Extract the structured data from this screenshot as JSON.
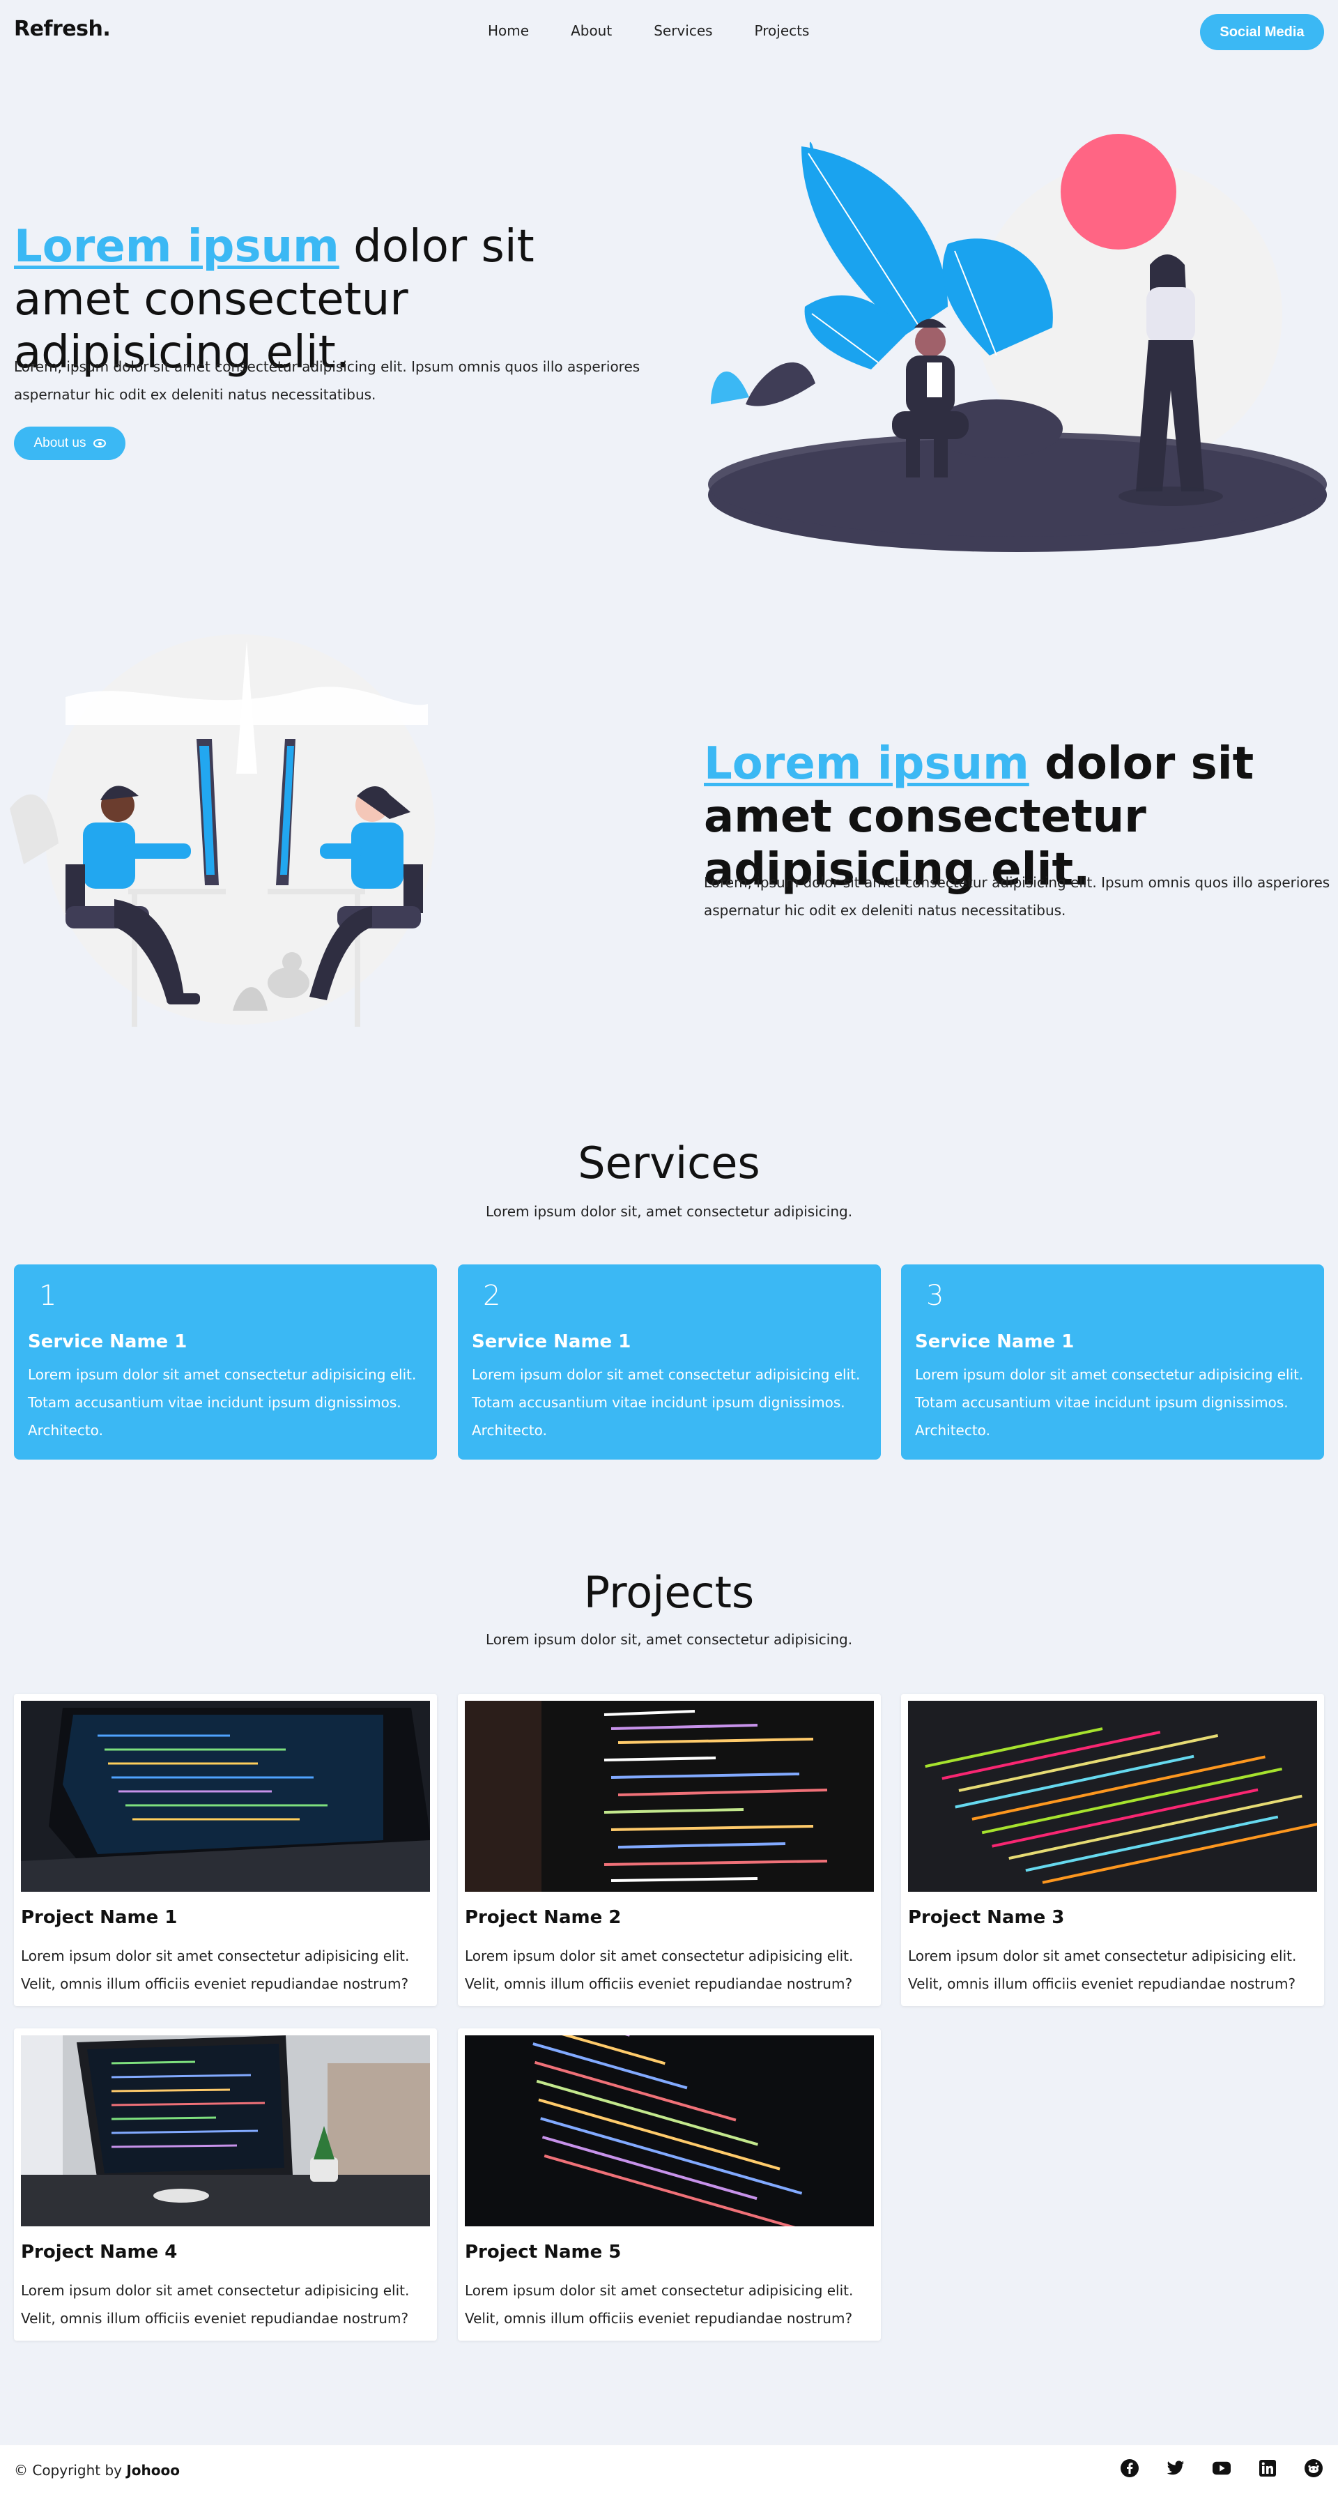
{
  "nav": {
    "logo": "Refresh.",
    "links": [
      "Home",
      "About",
      "Services",
      "Projects"
    ],
    "cta": "Social Media"
  },
  "hero": {
    "title_accent": "Lorem ipsum",
    "title_rest": " dolor sit amet consectetur adipisicing elit.",
    "text": "Lorem, ipsum dolor sit amet consectetur adipisicing elit. Ipsum omnis quos illo asperiores aspernatur hic odit ex deleniti natus necessitatibus.",
    "button": "About us"
  },
  "about": {
    "title_accent": "Lorem ipsum",
    "title_rest": " dolor sit amet consectetur adipisicing elit.",
    "text": "Lorem, ipsum dolor sit amet consectetur adipisicing elit. Ipsum omnis quos illo asperiores aspernatur hic odit ex deleniti natus necessitatibus."
  },
  "services": {
    "heading": "Services",
    "subtitle": "Lorem ipsum dolor sit, amet consectetur adipisicing.",
    "items": [
      {
        "num": "1",
        "name": "Service Name 1",
        "desc": "Lorem ipsum dolor sit amet consectetur adipisicing elit. Totam accusantium vitae incidunt ipsum dignissimos. Architecto."
      },
      {
        "num": "2",
        "name": "Service Name 1",
        "desc": "Lorem ipsum dolor sit amet consectetur adipisicing elit. Totam accusantium vitae incidunt ipsum dignissimos. Architecto."
      },
      {
        "num": "3",
        "name": "Service Name 1",
        "desc": "Lorem ipsum dolor sit amet consectetur adipisicing elit. Totam accusantium vitae incidunt ipsum dignissimos. Architecto."
      }
    ]
  },
  "projects": {
    "heading": "Projects",
    "subtitle": "Lorem ipsum dolor sit, amet consectetur adipisicing.",
    "items": [
      {
        "name": "Project Name 1",
        "desc": "Lorem ipsum dolor sit amet consectetur adipisicing elit. Velit, omnis illum officiis eveniet repudiandae nostrum?"
      },
      {
        "name": "Project Name 2",
        "desc": "Lorem ipsum dolor sit amet consectetur adipisicing elit. Velit, omnis illum officiis eveniet repudiandae nostrum?"
      },
      {
        "name": "Project Name 3",
        "desc": "Lorem ipsum dolor sit amet consectetur adipisicing elit. Velit, omnis illum officiis eveniet repudiandae nostrum?"
      },
      {
        "name": "Project Name 4",
        "desc": "Lorem ipsum dolor sit amet consectetur adipisicing elit. Velit, omnis illum officiis eveniet repudiandae nostrum?"
      },
      {
        "name": "Project Name 5",
        "desc": "Lorem ipsum dolor sit amet consectetur adipisicing elit. Velit, omnis illum officiis eveniet repudiandae nostrum?"
      }
    ]
  },
  "footer": {
    "copy_prefix": "© Copyright by ",
    "author": "Johooo",
    "social_icons": [
      "facebook-icon",
      "twitter-icon",
      "youtube-icon",
      "linkedin-icon",
      "reddit-icon"
    ]
  },
  "colors": {
    "accent": "#3bb8f4",
    "background": "#eff2f8",
    "dark": "#3f3d56",
    "pink": "#ff6584"
  }
}
